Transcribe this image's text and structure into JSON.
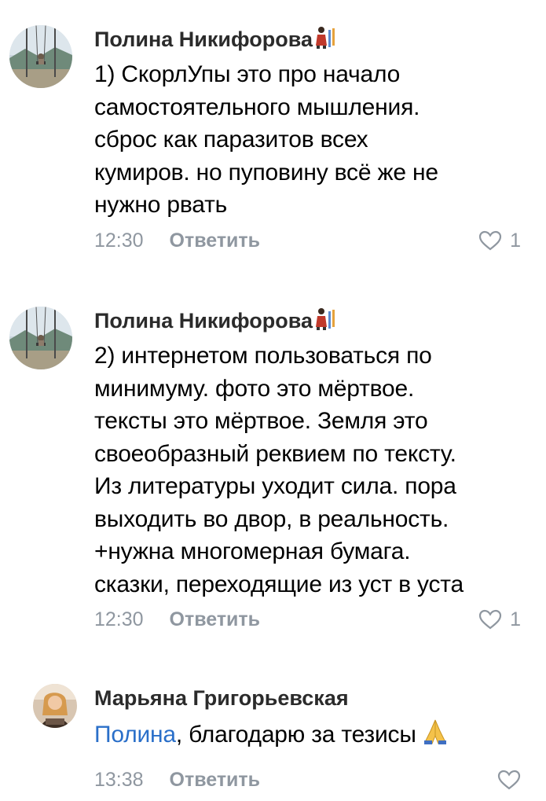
{
  "comments": [
    {
      "author": "Полина Никифорова",
      "author_emoji": "person-with-tools-emoji",
      "lines": [
        "1) СкорлУпы это про начало",
        "самостоятельного мышления.",
        "сброс как паразитов всех",
        "кумиров. но пуповину всё же не",
        "нужно рвать"
      ],
      "time": "12:30",
      "reply_label": "Ответить",
      "likes": "1"
    },
    {
      "author": "Полина Никифорова",
      "author_emoji": "person-with-tools-emoji",
      "lines": [
        "2) интернетом пользоваться по",
        "минимуму. фото это мёртвое.",
        "тексты это мёртвое. Земля это",
        "своеобразный реквием по тексту.",
        "Из литературы уходит сила. пора",
        "выходить во двор, в реальность.",
        "+нужна многомерная бумага.",
        "сказки, переходящие из уст в уста"
      ],
      "time": "12:30",
      "reply_label": "Ответить",
      "likes": "1"
    },
    {
      "author": "Марьяна Григорьевская",
      "mention": "Полина",
      "text_after_mention": ", благодарю за тезисы",
      "text_emoji": "folded-hands-emoji",
      "time": "13:38",
      "reply_label": "Ответить"
    }
  ],
  "colors": {
    "text": "#000000",
    "author": "#2b2b2b",
    "meta": "#8f97a0",
    "mention": "#2a6fc9"
  }
}
